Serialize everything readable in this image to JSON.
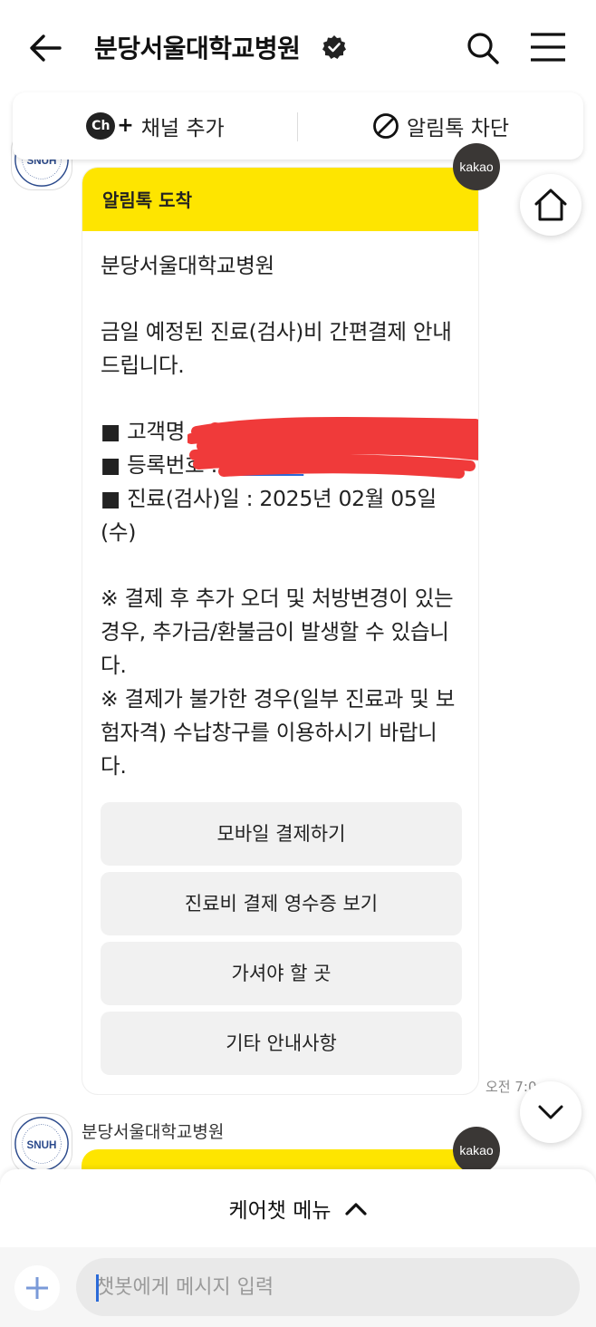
{
  "header": {
    "title": "분당서울대학교병원"
  },
  "channel_bar": {
    "ch_icon_text": "Ch",
    "add_label": "채널 추가",
    "block_label": "알림톡 차단"
  },
  "message": {
    "header": "알림톡 도착",
    "sender": "분당서울대학교병원",
    "intro": "금일 예정된 진료(검사)비 간편결제 안내드립니다.",
    "customer_label": "■ 고객명 : ",
    "reg_label": "■ 등록번호 : ",
    "date_line": "■ 진료(검사)일 : 2025년 02월 05일 (수)",
    "note1": "※ 결제 후 추가 오더 및 처방변경이 있는 경우, 추가금/환불금이 발생할 수 있습니다.",
    "note2": "※ 결제가 불가한 경우(일부 진료과 및 보험자격) 수납창구를 이용하시기 바랍니다.",
    "buttons": [
      "모바일 결제하기",
      "진료비 결제 영수증 보기",
      "가셔야 할 곳",
      "기타 안내사항"
    ],
    "time": "오전 7:0"
  },
  "badge": {
    "kakao": "kakao"
  },
  "second_message": {
    "sender": "분당서울대학교병원"
  },
  "bottom": {
    "menu_label": "케어챗 메뉴",
    "input_placeholder": "챗봇에게 메시지 입력"
  },
  "avatar": {
    "text": "SNUH"
  },
  "colors": {
    "kakao_yellow": "#fee500",
    "badge_dark": "#3a3735",
    "redaction": "#f03a3a"
  }
}
